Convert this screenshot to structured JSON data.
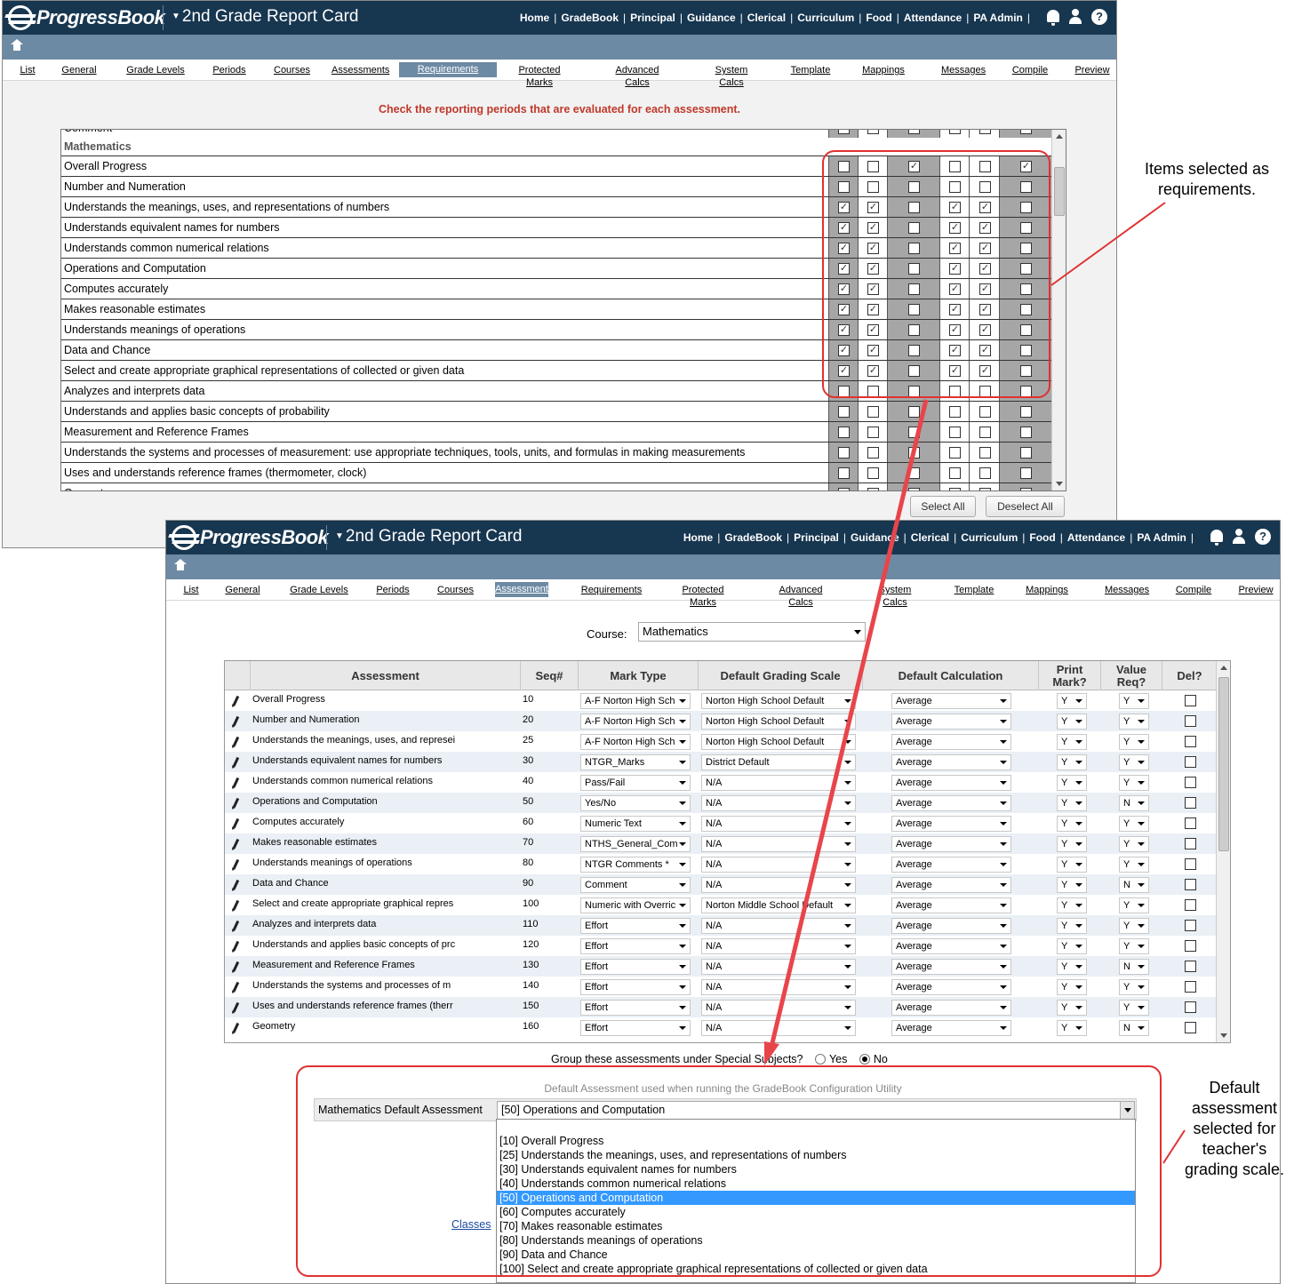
{
  "app": {
    "logo_text": "ProgressBook",
    "title": "2nd Grade Report Card",
    "nav": [
      "Home",
      "GradeBook",
      "Principal",
      "Guidance",
      "Clerical",
      "Curriculum",
      "Food",
      "Attendance",
      "PA Admin"
    ],
    "icons": [
      "bell-icon",
      "user-icon",
      "help-icon",
      "home-icon"
    ],
    "help_glyph": "?",
    "tabs": [
      "List",
      "General",
      "Grade Levels",
      "Periods",
      "Courses",
      "Assessments",
      "Requirements",
      "Protected Marks",
      "Advanced Calcs",
      "System Calcs",
      "Template",
      "Mappings",
      "Messages",
      "Compile",
      "Preview"
    ]
  },
  "requirements_window": {
    "active_tab": "Requirements",
    "instruction": "Check the reporting periods that are evaluated for each assessment.",
    "partial_top_row": "Comment",
    "section": "Mathematics",
    "rows": [
      {
        "label": "Overall Progress",
        "checks": [
          false,
          false,
          true,
          false,
          false,
          true
        ]
      },
      {
        "label": "Number and Numeration",
        "checks": [
          false,
          false,
          false,
          false,
          false,
          false
        ]
      },
      {
        "label": "Understands the meanings, uses, and representations of numbers",
        "checks": [
          true,
          true,
          false,
          true,
          true,
          false
        ]
      },
      {
        "label": "Understands equivalent names for numbers",
        "checks": [
          true,
          true,
          false,
          true,
          true,
          false
        ]
      },
      {
        "label": "Understands common numerical relations",
        "checks": [
          true,
          true,
          false,
          true,
          true,
          false
        ]
      },
      {
        "label": "Operations and Computation",
        "checks": [
          true,
          true,
          false,
          true,
          true,
          false
        ]
      },
      {
        "label": "Computes accurately",
        "checks": [
          true,
          true,
          false,
          true,
          true,
          false
        ]
      },
      {
        "label": "Makes reasonable estimates",
        "checks": [
          true,
          true,
          false,
          true,
          true,
          false
        ]
      },
      {
        "label": "Understands meanings of operations",
        "checks": [
          true,
          true,
          false,
          true,
          true,
          false
        ]
      },
      {
        "label": "Data and Chance",
        "checks": [
          true,
          true,
          false,
          true,
          true,
          false
        ]
      },
      {
        "label": "Select and create appropriate graphical representations of collected or given data",
        "checks": [
          true,
          true,
          false,
          true,
          true,
          false
        ]
      },
      {
        "label": "Analyzes and interprets data",
        "checks": [
          false,
          false,
          false,
          false,
          false,
          false
        ]
      },
      {
        "label": "Understands and applies basic concepts of probability",
        "checks": [
          false,
          false,
          false,
          false,
          false,
          false
        ]
      },
      {
        "label": "Measurement and Reference Frames",
        "checks": [
          false,
          false,
          false,
          false,
          false,
          false
        ]
      },
      {
        "label": "Understands the systems and processes of measurement: use appropriate techniques, tools, units, and formulas in making measurements",
        "checks": [
          false,
          false,
          false,
          false,
          false,
          false
        ]
      },
      {
        "label": "Uses and understands reference frames (thermometer, clock)",
        "checks": [
          false,
          false,
          false,
          false,
          false,
          false
        ]
      }
    ],
    "partial_bottom_row": "Geometry",
    "select_all": "Select All",
    "deselect_all": "Deselect All"
  },
  "assessments_window": {
    "active_tab": "Assessments",
    "course_label": "Course:",
    "course_value": "Mathematics",
    "headers": [
      "Assessment",
      "Seq#",
      "Mark Type",
      "Default Grading Scale",
      "Default Calculation",
      "Print Mark?",
      "Value Req?",
      "Del?"
    ],
    "rows": [
      {
        "name": "Overall Progress",
        "seq": "10",
        "mark_type": "A-F Norton High Sch",
        "scale": "Norton High School Default",
        "calc": "Average",
        "print": "Y",
        "req": "Y"
      },
      {
        "name": "Number and Numeration",
        "seq": "20",
        "mark_type": "A-F Norton High Sch",
        "scale": "Norton High School Default",
        "calc": "Average",
        "print": "Y",
        "req": "Y"
      },
      {
        "name": "Understands the meanings, uses, and represei",
        "seq": "25",
        "mark_type": "A-F Norton High Sch",
        "scale": "Norton High School Default",
        "calc": "Average",
        "print": "Y",
        "req": "Y"
      },
      {
        "name": "Understands equivalent names for numbers",
        "seq": "30",
        "mark_type": "NTGR_Marks",
        "scale": "District Default",
        "calc": "Average",
        "print": "Y",
        "req": "Y"
      },
      {
        "name": "Understands common numerical relations",
        "seq": "40",
        "mark_type": "Pass/Fail",
        "scale": "N/A",
        "calc": "Average",
        "print": "Y",
        "req": "Y"
      },
      {
        "name": "Operations and Computation",
        "seq": "50",
        "mark_type": "Yes/No",
        "scale": "N/A",
        "calc": "Average",
        "print": "Y",
        "req": "N"
      },
      {
        "name": "Computes accurately",
        "seq": "60",
        "mark_type": "Numeric Text",
        "scale": "N/A",
        "calc": "Average",
        "print": "Y",
        "req": "Y"
      },
      {
        "name": "Makes reasonable estimates",
        "seq": "70",
        "mark_type": "NTHS_General_Com",
        "scale": "N/A",
        "calc": "Average",
        "print": "Y",
        "req": "Y"
      },
      {
        "name": "Understands meanings of operations",
        "seq": "80",
        "mark_type": "NTGR Comments *",
        "scale": "N/A",
        "calc": "Average",
        "print": "Y",
        "req": "Y"
      },
      {
        "name": "Data and Chance",
        "seq": "90",
        "mark_type": "Comment",
        "scale": "N/A",
        "calc": "Average",
        "print": "Y",
        "req": "N"
      },
      {
        "name": "Select and create appropriate graphical repres",
        "seq": "100",
        "mark_type": "Numeric with Overric",
        "scale": "Norton Middle School Default",
        "calc": "Average",
        "print": "Y",
        "req": "Y"
      },
      {
        "name": "Analyzes and interprets data",
        "seq": "110",
        "mark_type": "Effort",
        "scale": "N/A",
        "calc": "Average",
        "print": "Y",
        "req": "Y"
      },
      {
        "name": "Understands and applies basic concepts of prc",
        "seq": "120",
        "mark_type": "Effort",
        "scale": "N/A",
        "calc": "Average",
        "print": "Y",
        "req": "Y"
      },
      {
        "name": "Measurement and Reference Frames",
        "seq": "130",
        "mark_type": "Effort",
        "scale": "N/A",
        "calc": "Average",
        "print": "Y",
        "req": "N"
      },
      {
        "name": "Understands the systems and processes of m",
        "seq": "140",
        "mark_type": "Effort",
        "scale": "N/A",
        "calc": "Average",
        "print": "Y",
        "req": "Y"
      },
      {
        "name": "Uses and understands reference frames (therr",
        "seq": "150",
        "mark_type": "Effort",
        "scale": "N/A",
        "calc": "Average",
        "print": "Y",
        "req": "Y"
      },
      {
        "name": "Geometry",
        "seq": "160",
        "mark_type": "Effort",
        "scale": "N/A",
        "calc": "Average",
        "print": "Y",
        "req": "N"
      }
    ],
    "special_question": "Group these assessments under Special Subjects?",
    "special_yes": "Yes",
    "special_no": "No",
    "special_selected": "No",
    "default_heading": "Default Assessment used when running the GradeBook Configuration Utility",
    "default_label": "Mathematics Default Assessment",
    "default_value": "[50] Operations and Computation",
    "dropdown_options": [
      "[10] Overall Progress",
      "[25] Understands the meanings, uses, and representations of numbers",
      "[30] Understands equivalent names for numbers",
      "[40] Understands common numerical relations",
      "[50] Operations and Computation",
      "[60] Computes accurately",
      "[70] Makes reasonable estimates",
      "[80] Understands meanings of operations",
      "[90] Data and Chance",
      "[100] Select and create appropriate graphical representations of collected or given data"
    ],
    "dropdown_selected_index": 4,
    "classes_link": "Classes"
  },
  "annotations": {
    "callout_requirements": "Items selected as requirements.",
    "callout_default": "Default assessment selected for teacher's grading scale.",
    "accent_color": "#e03131"
  }
}
